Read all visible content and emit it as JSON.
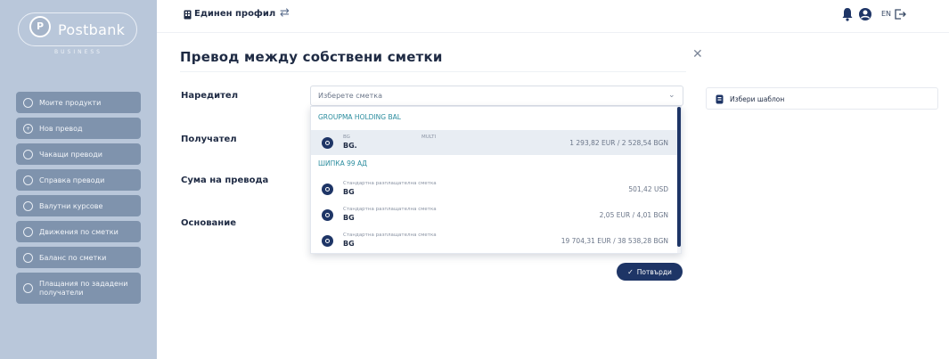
{
  "brand": {
    "name": "Postbank",
    "subtitle": "BUSINESS"
  },
  "sidebar": {
    "items": [
      {
        "label": "Моите продукти",
        "icon": "home-icon"
      },
      {
        "label": "Нов превод",
        "icon": "plus-circle-icon"
      },
      {
        "label": "Чакащи преводи",
        "icon": "clock-icon"
      },
      {
        "label": "Справка преводи",
        "icon": "document-icon"
      },
      {
        "label": "Валутни курсове",
        "icon": "currency-icon"
      },
      {
        "label": "Движения по сметки",
        "icon": "transactions-icon"
      },
      {
        "label": "Баланс по сметки",
        "icon": "balance-icon"
      },
      {
        "label": "Плащания по зададени получатели",
        "icon": "payees-icon"
      }
    ]
  },
  "topbar": {
    "profile_label": "Единен профил",
    "language": "EN"
  },
  "form": {
    "title": "Превод между собствени сметки",
    "labels": {
      "sender": "Наредител",
      "recipient": "Получател",
      "amount": "Сума на превода",
      "reason": "Основание"
    },
    "select_placeholder": "Изберете сметка",
    "confirm_label": "Потвърди",
    "template_label": "Избери шаблон"
  },
  "dropdown": {
    "groups": [
      {
        "name": "GROUPMA HOLDING BAL",
        "accounts": [
          {
            "type": "BG",
            "currency": "MULTI",
            "number": "BG.",
            "balance": "1 293,82 EUR / 2 528,54 BGN",
            "selected": true
          }
        ]
      },
      {
        "name": "ШИПКА 99 АД",
        "accounts": [
          {
            "type": "Стандартна разплащателна сметка",
            "number": "BG",
            "balance": "501,42 USD",
            "selected": false
          },
          {
            "type": "Стандартна разплащателна сметка",
            "number": "BG",
            "balance": "2,05 EUR / 4,01 BGN",
            "selected": false
          },
          {
            "type": "Стандартна разплащателна сметка",
            "number": "BG",
            "balance": "19 704,31 EUR / 38 538,28 BGN",
            "selected": false
          }
        ]
      }
    ]
  },
  "colors": {
    "sidebar_bg": "#b9c7da",
    "nav_item_bg": "#7f93ad",
    "primary": "#1e3566",
    "group_label": "#2a8c9e"
  }
}
